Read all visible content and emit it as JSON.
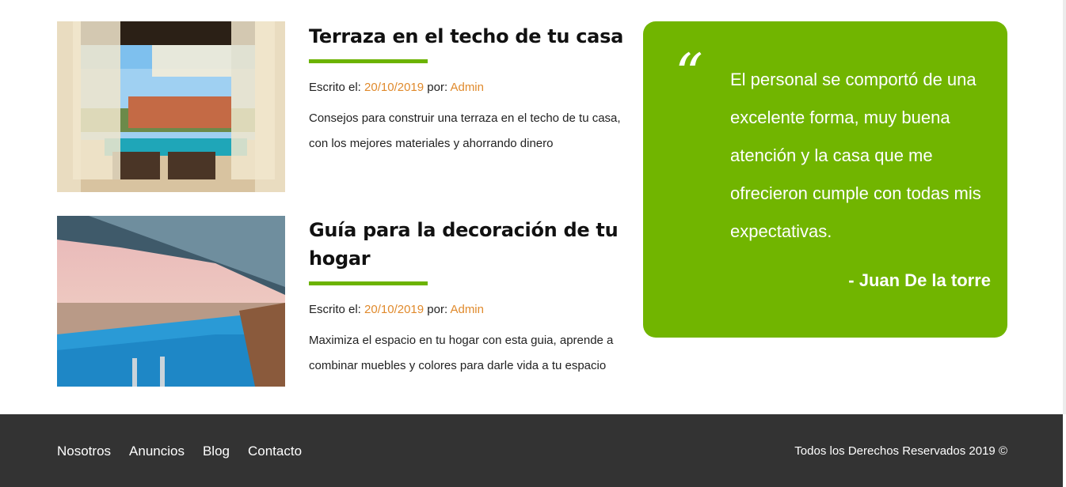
{
  "posts": [
    {
      "title": "Terraza en el techo de tu casa",
      "meta_prefix": "Escrito el: ",
      "date": "20/10/2019",
      "by_label": " por: ",
      "author": "Admin",
      "excerpt": "Consejos para construir una terraza en el techo de tu casa, con los mejores materiales y ahorrando dinero"
    },
    {
      "title": "Guía para la decoración de tu hogar",
      "meta_prefix": "Escrito el: ",
      "date": "20/10/2019",
      "by_label": " por: ",
      "author": "Admin",
      "excerpt": "Maximiza el espacio en tu hogar con esta guia, aprende a combinar muebles y colores para darle vida a tu espacio"
    }
  ],
  "testimonial": {
    "quote_mark": "“",
    "text": "El personal se comportó de una excelente forma, muy buena atención y la casa que me ofrecieron cumple con todas mis expectativas.",
    "author": "- Juan De la torre"
  },
  "footer": {
    "nav": [
      "Nosotros",
      "Anuncios",
      "Blog",
      "Contacto"
    ],
    "copyright": "Todos los Derechos Reservados 2019 ©"
  },
  "colors": {
    "accent_green": "#71b500",
    "link_orange": "#e08a2c",
    "footer_bg": "#333333"
  },
  "icons": [
    "terrace-photo",
    "pool-photo",
    "quote-icon"
  ]
}
